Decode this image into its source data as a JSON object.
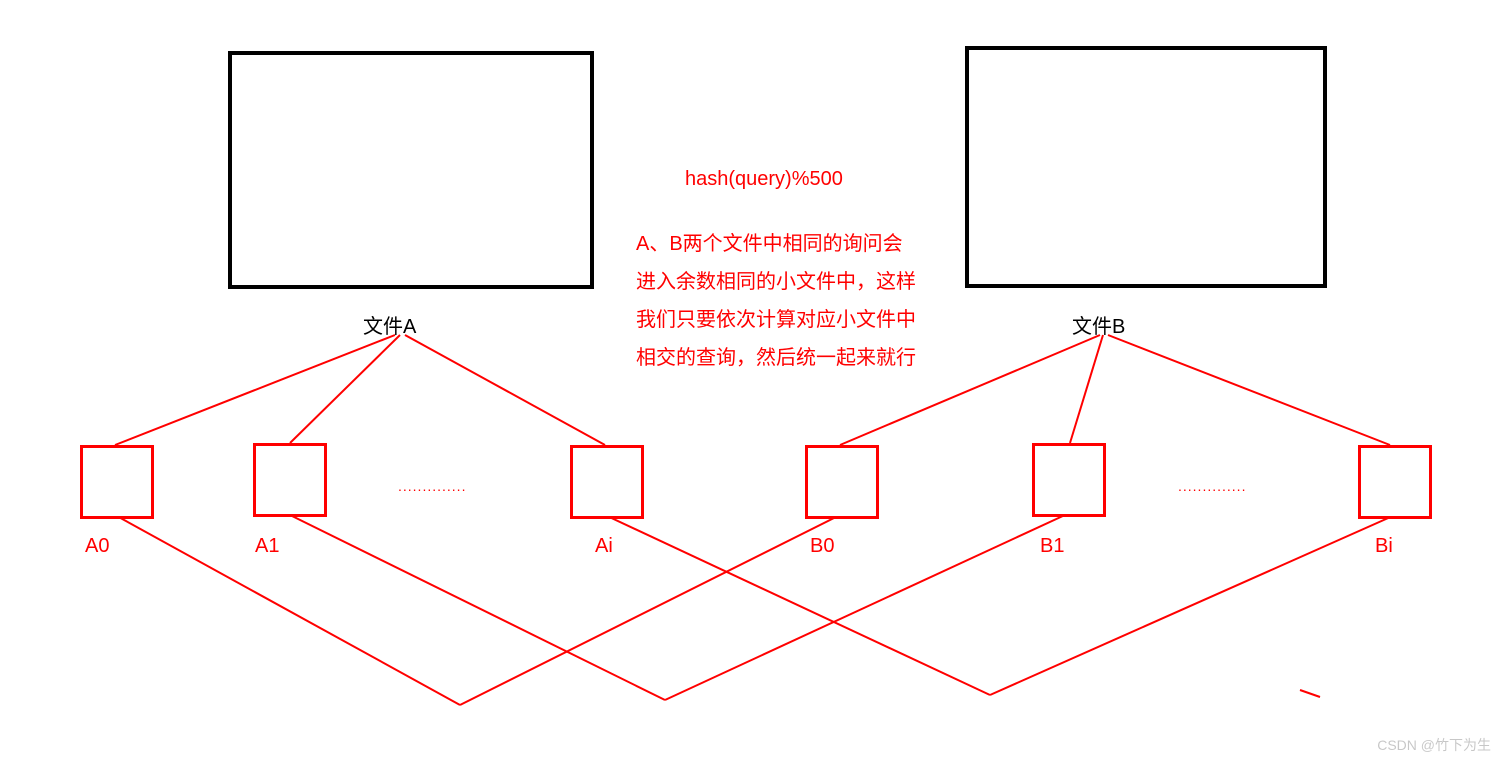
{
  "fileA": {
    "label": "文件A"
  },
  "fileB": {
    "label": "文件B"
  },
  "hashFormula": "hash(query)%500",
  "explanation": "A、B两个文件中相同的询问会\n进入余数相同的小文件中，这样\n我们只要依次计算对应小文件中\n相交的查询，然后统一起来就行",
  "subfilesA": [
    "A0",
    "A1",
    "Ai"
  ],
  "subfilesB": [
    "B0",
    "B1",
    "Bi"
  ],
  "ellipsisA": "..............",
  "ellipsisB": "..............",
  "watermark": "CSDN @竹下为生"
}
